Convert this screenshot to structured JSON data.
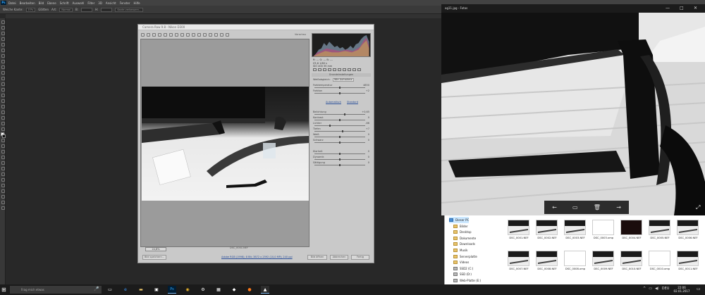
{
  "photoshop": {
    "logo": "Ps",
    "menu": [
      "Datei",
      "Bearbeiten",
      "Bild",
      "Ebene",
      "Schrift",
      "Auswahl",
      "Filter",
      "3D",
      "Ansicht",
      "Fenster",
      "Hilfe"
    ],
    "options": {
      "feather_label": "Weiche Kante:",
      "feather_value": "0 Px",
      "antialias": "Glätten",
      "style_label": "Art:",
      "style_value": "Normal",
      "width_label": "B:",
      "height_label": "H:",
      "refine": "Kante verbessern..."
    },
    "colors": {
      "foreground": "#ffffff",
      "background": "#111111"
    }
  },
  "camera_raw": {
    "title": "Camera Raw 9.8 - Nikon D300",
    "preview_label": "Vorschau",
    "zoom": "24,8%",
    "image_status": "DSC_0001.NEF",
    "readout": {
      "r_g_b": "R: --- G: --- B: ---",
      "f_line": "f/5,6  1/60 s",
      "iso_line": "ISO 400  35 mm"
    },
    "section_title": "Grundeinstellungen",
    "white_balance_label": "Weißabgleich:",
    "white_balance_value": "Wie Aufnahme",
    "links": {
      "auto": "Automatisch",
      "default": "Standard"
    },
    "sliders": [
      {
        "label": "Farbtemperatur",
        "value": "4850"
      },
      {
        "label": "Farbton",
        "value": "+2"
      },
      {
        "label": "Belichtung",
        "value": "+0,65"
      },
      {
        "label": "Kontrast",
        "value": "0"
      },
      {
        "label": "Lichter",
        "value": "-66"
      },
      {
        "label": "Tiefen",
        "value": "+7"
      },
      {
        "label": "Weiß",
        "value": "0"
      },
      {
        "label": "Schwarz",
        "value": "0"
      },
      {
        "label": "Klarheit",
        "value": "0"
      },
      {
        "label": "Dynamik",
        "value": "0"
      },
      {
        "label": "Sättigung",
        "value": "0"
      }
    ],
    "footer_link": "Adobe RGB (1998); 8 Bit; 3872 x 2592 (10,0 MP); 240 ppi",
    "buttons": {
      "save": "Bild speichern...",
      "open": "Bild öffnen",
      "cancel": "Abbrechen",
      "done": "Fertig"
    }
  },
  "photos": {
    "title": "og11.jpg - Fotos",
    "window_buttons": [
      "—",
      "□",
      "✕"
    ],
    "toolbar": [
      "←",
      "▭",
      "🗑",
      "→"
    ],
    "expand_icon": "⤢"
  },
  "explorer": {
    "tree": [
      {
        "label": "Dieser PC",
        "kind": "pc"
      },
      {
        "label": "Bilder",
        "kind": "folder"
      },
      {
        "label": "Desktop",
        "kind": "folder"
      },
      {
        "label": "Dokumente",
        "kind": "folder"
      },
      {
        "label": "Downloads",
        "kind": "folder"
      },
      {
        "label": "Musik",
        "kind": "folder"
      },
      {
        "label": "Serverplatte",
        "kind": "folder"
      },
      {
        "label": "Videos",
        "kind": "folder"
      },
      {
        "label": "SSD2 (C:)",
        "kind": "drive"
      },
      {
        "label": "SSD (D:)",
        "kind": "drive"
      },
      {
        "label": "Web-Platte (E:)",
        "kind": "drive"
      }
    ],
    "files": [
      {
        "name": "DSC_0001.NEF",
        "kind": "photo"
      },
      {
        "name": "DSC_0002.NEF",
        "kind": "photo"
      },
      {
        "name": "DSC_0003.NEF",
        "kind": "photo"
      },
      {
        "name": "DSC_0003.xmp",
        "kind": "doc"
      },
      {
        "name": "DSC_0004.NEF",
        "kind": "dark"
      },
      {
        "name": "DSC_0005.NEF",
        "kind": "photo"
      },
      {
        "name": "DSC_0006.NEF",
        "kind": "photo"
      },
      {
        "name": "DSC_0007.NEF",
        "kind": "photo"
      },
      {
        "name": "DSC_0008.NEF",
        "kind": "photo"
      },
      {
        "name": "DSC_0008.xmp",
        "kind": "doc"
      },
      {
        "name": "DSC_0009.NEF",
        "kind": "photo"
      },
      {
        "name": "DSC_0010.NEF",
        "kind": "photo"
      },
      {
        "name": "DSC_0010.xmp",
        "kind": "doc"
      },
      {
        "name": "DSC_0011.NEF",
        "kind": "photo"
      }
    ]
  },
  "taskbar": {
    "search_placeholder": "Frag mich etwas",
    "apps": [
      {
        "icon": "task-view-icon",
        "glyph": "▭"
      },
      {
        "icon": "edge-icon",
        "glyph": "e"
      },
      {
        "icon": "folder-icon",
        "glyph": "▬"
      },
      {
        "icon": "store-icon",
        "glyph": "▣"
      },
      {
        "icon": "photoshop-icon",
        "glyph": "Ps"
      },
      {
        "icon": "chrome-icon",
        "glyph": "◉"
      },
      {
        "icon": "settings-icon",
        "glyph": "⚙"
      },
      {
        "icon": "calculator-icon",
        "glyph": "▦"
      },
      {
        "icon": "app-icon",
        "glyph": "◆"
      },
      {
        "icon": "firefox-icon",
        "glyph": "●"
      },
      {
        "icon": "photos-icon",
        "glyph": "▲"
      }
    ],
    "tray": [
      "^",
      "▭",
      "◀)",
      "DEU"
    ],
    "time": "22:06",
    "date": "02.01.2017"
  }
}
